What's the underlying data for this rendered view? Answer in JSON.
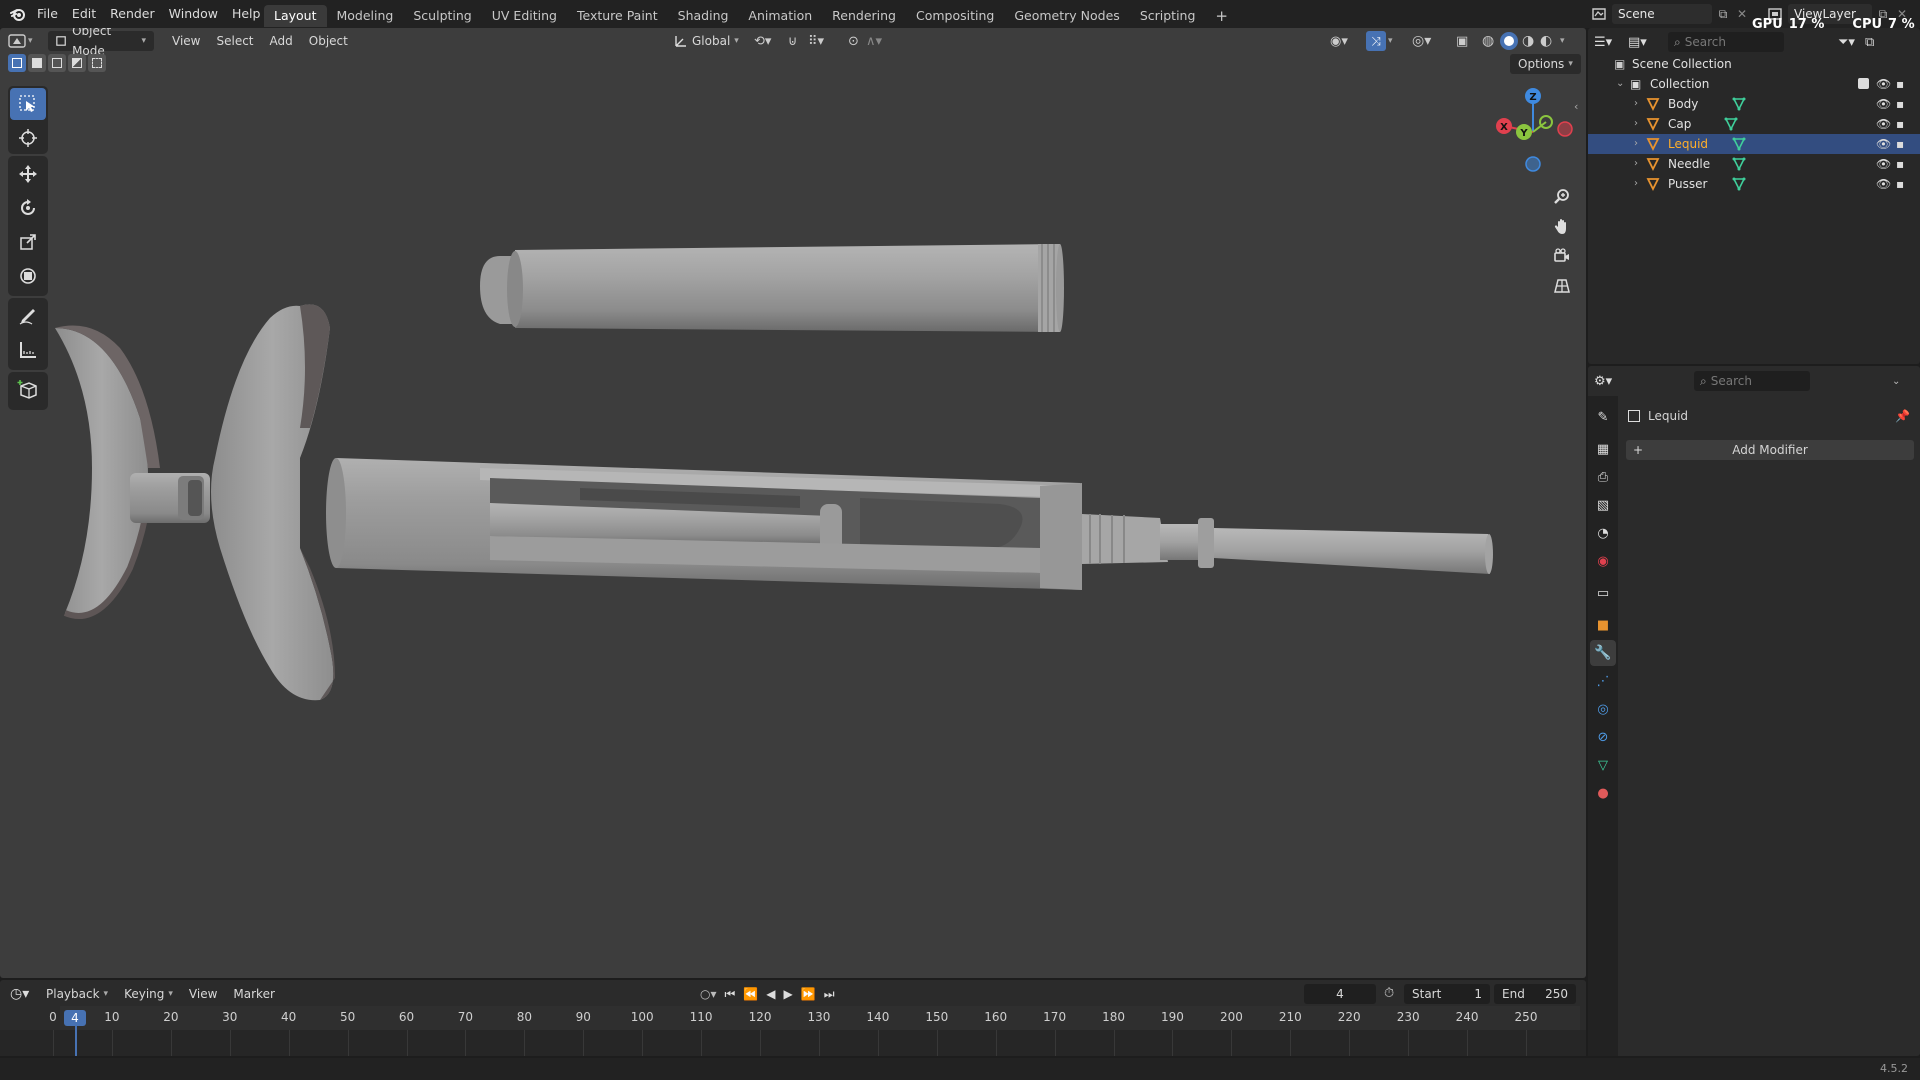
{
  "menus": [
    "File",
    "Edit",
    "Render",
    "Window",
    "Help"
  ],
  "workspaces": [
    "Layout",
    "Modeling",
    "Sculpting",
    "UV Editing",
    "Texture Paint",
    "Shading",
    "Animation",
    "Rendering",
    "Compositing",
    "Geometry Nodes",
    "Scripting"
  ],
  "add_workspace": "+",
  "scene_name": "Scene",
  "view_layer": "ViewLayer",
  "gpu_label": "GPU",
  "gpu_value": "17 %",
  "cpu_label": "CPU",
  "cpu_value": "7 %",
  "viewport": {
    "mode": "Object Mode",
    "menus": [
      "View",
      "Select",
      "Add",
      "Object"
    ],
    "orientation": "Global",
    "options_label": "Options",
    "gizmo_axes": [
      "Z",
      "X",
      "Y"
    ]
  },
  "outliner": {
    "search_placeholder": "Search",
    "root": "Scene Collection",
    "collection": "Collection",
    "items": [
      {
        "name": "Body",
        "selected": false
      },
      {
        "name": "Cap",
        "selected": false
      },
      {
        "name": "Lequid",
        "selected": true
      },
      {
        "name": "Needle",
        "selected": false
      },
      {
        "name": "Pusser",
        "selected": false
      }
    ]
  },
  "properties": {
    "search_placeholder": "Search",
    "object_name": "Lequid",
    "add_modifier": "Add Modifier"
  },
  "timeline": {
    "menus": [
      "Playback",
      "Keying",
      "View",
      "Marker"
    ],
    "current_frame": "4",
    "start_label": "Start",
    "start_value": "1",
    "end_label": "End",
    "end_value": "250",
    "ticks": [
      "0",
      "10",
      "20",
      "30",
      "40",
      "50",
      "60",
      "70",
      "80",
      "90",
      "100",
      "110",
      "120",
      "130",
      "140",
      "150",
      "160",
      "170",
      "180",
      "190",
      "200",
      "210",
      "220",
      "230",
      "240",
      "250"
    ],
    "playhead": "4"
  },
  "version": "4.5.2",
  "colors": {
    "accent": "#4772b3",
    "selected_row": "#334d80",
    "object_orange": "#e8932f",
    "mesh_green": "#3fcf9b",
    "axis_x": "#e0404e",
    "axis_y": "#8bc53f",
    "axis_z": "#3f8ae0"
  }
}
